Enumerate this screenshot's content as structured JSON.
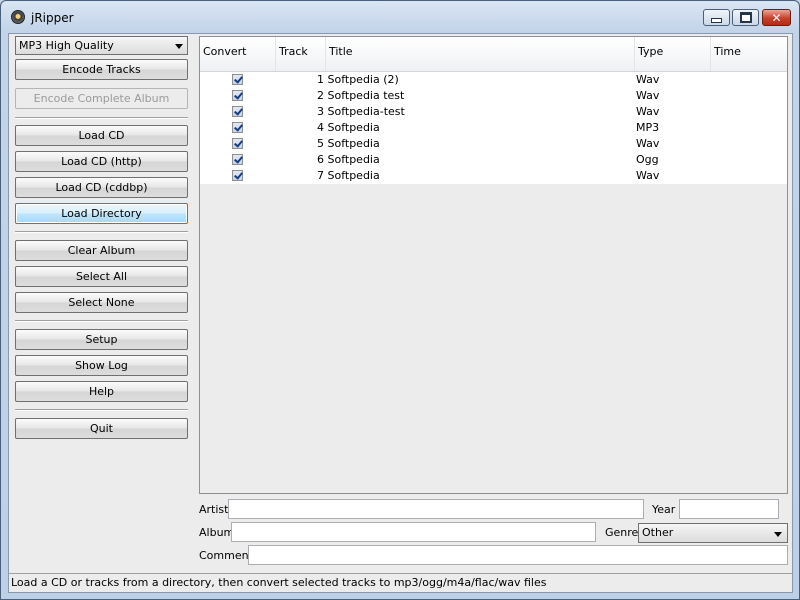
{
  "window": {
    "title": "jRipper"
  },
  "encoder": {
    "selected": "MP3 High Quality"
  },
  "buttons": {
    "encode_tracks": "Encode Tracks",
    "encode_album": "Encode Complete Album",
    "load_cd": "Load CD",
    "load_cd_http": "Load CD (http)",
    "load_cd_cddbp": "Load CD (cddbp)",
    "load_directory": "Load Directory",
    "clear_album": "Clear Album",
    "select_all": "Select All",
    "select_none": "Select None",
    "setup": "Setup",
    "show_log": "Show Log",
    "help": "Help",
    "quit": "Quit"
  },
  "table": {
    "columns": [
      "Convert",
      "Track",
      "Title",
      "Type",
      "Time"
    ],
    "rows": [
      {
        "checked": true,
        "title": "1 Softpedia (2)",
        "type": "Wav"
      },
      {
        "checked": true,
        "title": "2 Softpedia test",
        "type": "Wav"
      },
      {
        "checked": true,
        "title": "3 Softpedia-test",
        "type": "Wav"
      },
      {
        "checked": true,
        "title": "4 Softpedia",
        "type": "MP3"
      },
      {
        "checked": true,
        "title": "5 Softpedia",
        "type": "Wav"
      },
      {
        "checked": true,
        "title": "6 Softpedia",
        "type": "Ogg"
      },
      {
        "checked": true,
        "title": "7 Softpedia",
        "type": "Wav"
      }
    ]
  },
  "fields": {
    "artist_label": "Artist",
    "artist_value": "",
    "year_label": "Year",
    "year_value": "",
    "album_label": "Album",
    "album_value": "",
    "genre_label": "Genre",
    "genre_value": "Other",
    "comment_label": "Comment",
    "comment_value": ""
  },
  "status": "Load a CD or tracks from a directory, then convert selected tracks to mp3/ogg/m4a/flac/wav files"
}
